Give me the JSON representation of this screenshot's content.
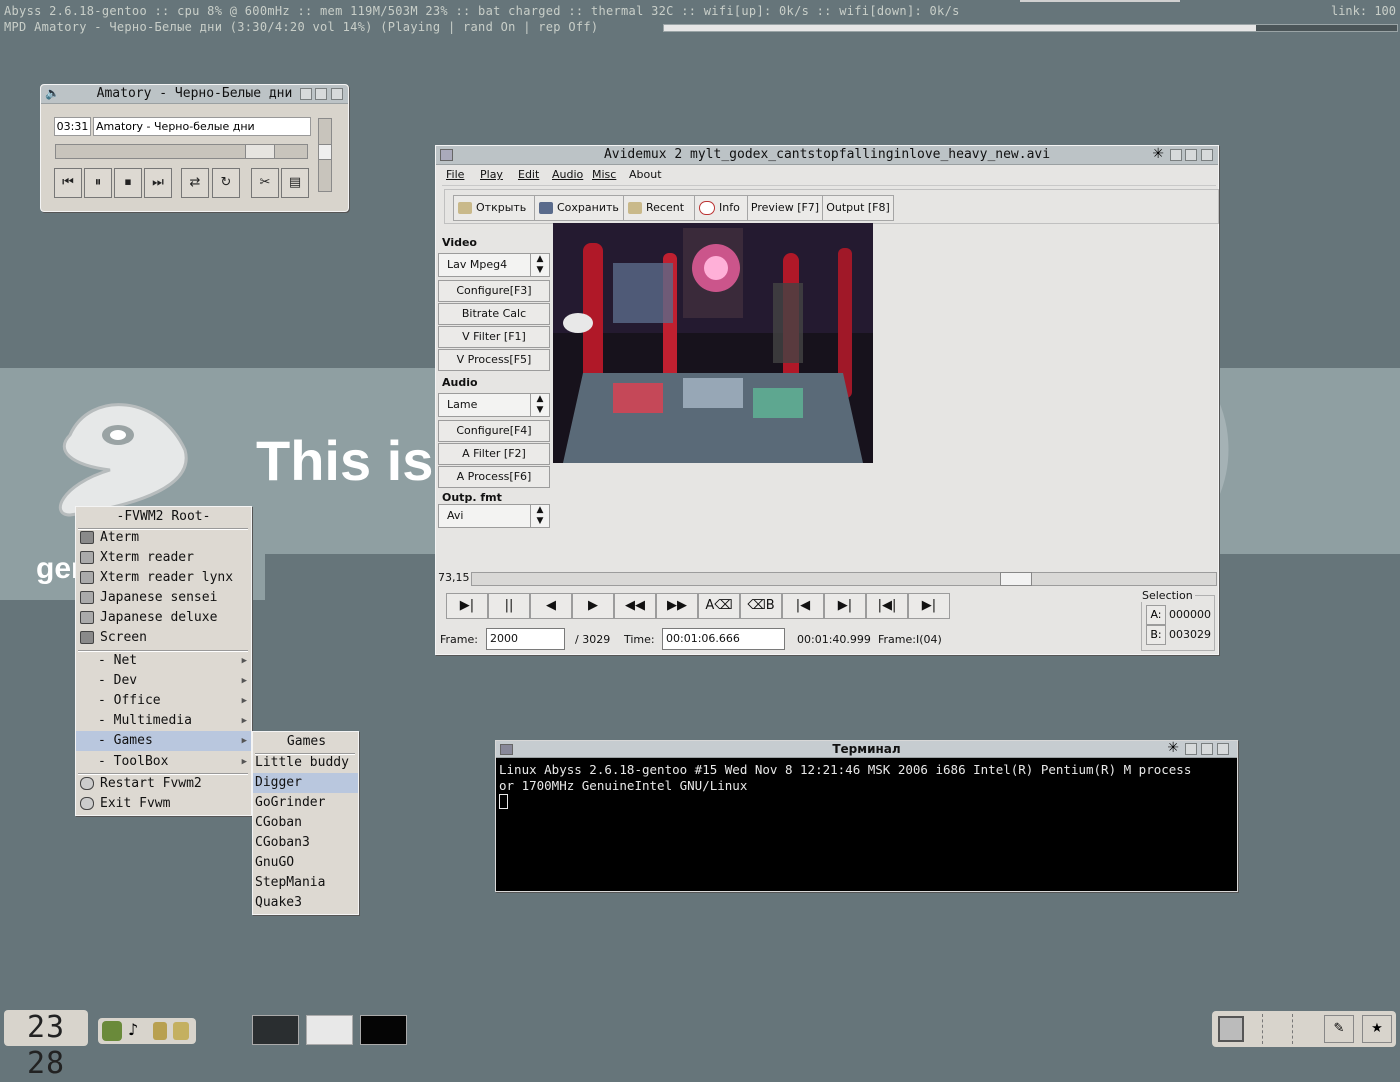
{
  "statusbar": {
    "line1": "Abyss 2.6.18-gentoo :: cpu 8% @ 600mHz :: mem 119M/503M 23% :: bat charged :: thermal 32C :: wifi[up]: 0k/s :: wifi[down]: 0k/s",
    "line2": "MPD  Amatory - Черно-Белые дни  (3:30/4:20 vol 14%) (Playing | rand On | rep Off)",
    "link": "link: 100",
    "mpd_progress": 0.808
  },
  "wallpaper": {
    "text": "This is",
    "url": "gentoo.org"
  },
  "xmms": {
    "title": "Amatory - Черно-Белые дни",
    "time": "03:31",
    "song": "Amatory - Черно-белые дни",
    "seek_fraction": 0.81,
    "volume_fraction": 0.55,
    "buttons": [
      "⏮",
      "⏸",
      "⏹",
      "⏭",
      "⇄",
      "↻",
      "✂",
      "▤"
    ]
  },
  "avidemux": {
    "title": "Avidemux 2 mylt_godex_cantstopfallinginlove_heavy_new.avi",
    "menu": [
      "File",
      "Play",
      "Edit",
      "Audio",
      "Misc",
      "About"
    ],
    "toolbar": {
      "open": "Открыть",
      "save": "Сохранить",
      "recent": "Recent",
      "info": "Info",
      "preview": "Preview [F7]",
      "output": "Output [F8]"
    },
    "video_section": {
      "label": "Video",
      "codec": "Lav Mpeg4",
      "configure": "Configure[F3]",
      "bitrate": "Bitrate Calc",
      "filter": "V Filter   [F1]",
      "process": "V Process[F5]"
    },
    "audio_section": {
      "label": "Audio",
      "codec": "Lame",
      "configure": "Configure[F4]",
      "filter": "A Filter   [F2]",
      "process": "A Process[F6]"
    },
    "output_section": {
      "label": "Outp. fmt",
      "format": "Avi"
    },
    "position": "73,15",
    "slider_fraction": 0.73,
    "nav_buttons": [
      "▶|",
      "||",
      "◀",
      "▶",
      "◀◀",
      "▶▶",
      "A⌫",
      "⌫B",
      "|◀",
      "▶|",
      "|◀|",
      "▶|"
    ],
    "frame_label": "Frame:",
    "frame_value": "2000",
    "frame_total": "/ 3029",
    "time_label": "Time:",
    "time_value": "00:01:06.666",
    "duration": "00:01:40.999",
    "frame_type": "Frame:I(04)",
    "selection": {
      "title": "Selection",
      "a_label": "A:",
      "a_value": "000000",
      "b_label": "B:",
      "b_value": "003029"
    }
  },
  "terminal": {
    "title": "Терминал",
    "line1": "Linux Abyss 2.6.18-gentoo #15 Wed Nov 8 12:21:46 MSK 2006 i686 Intel(R) Pentium(R) M process",
    "line2": "or 1700MHz GenuineIntel GNU/Linux"
  },
  "fvwm_menu": {
    "title": "-FVWM2 Root-",
    "items": [
      "Aterm",
      "Xterm reader",
      "Xterm reader lynx",
      "Japanese sensei",
      "Japanese deluxe",
      "Screen"
    ],
    "submenus": [
      "- Net",
      "- Dev",
      "- Office",
      "- Multimedia",
      "- Games",
      "- ToolBox"
    ],
    "actions": [
      "Restart Fvwm2",
      "Exit Fvwm"
    ],
    "selected": "- Games"
  },
  "games_menu": {
    "title": "Games",
    "items": [
      "Little buddy",
      "Digger",
      "GoGrinder",
      "CGoban",
      "CGoban3",
      "GnuGO",
      "StepMania",
      "Quake3"
    ],
    "selected": "Digger"
  },
  "panel": {
    "clock": "23 28"
  }
}
